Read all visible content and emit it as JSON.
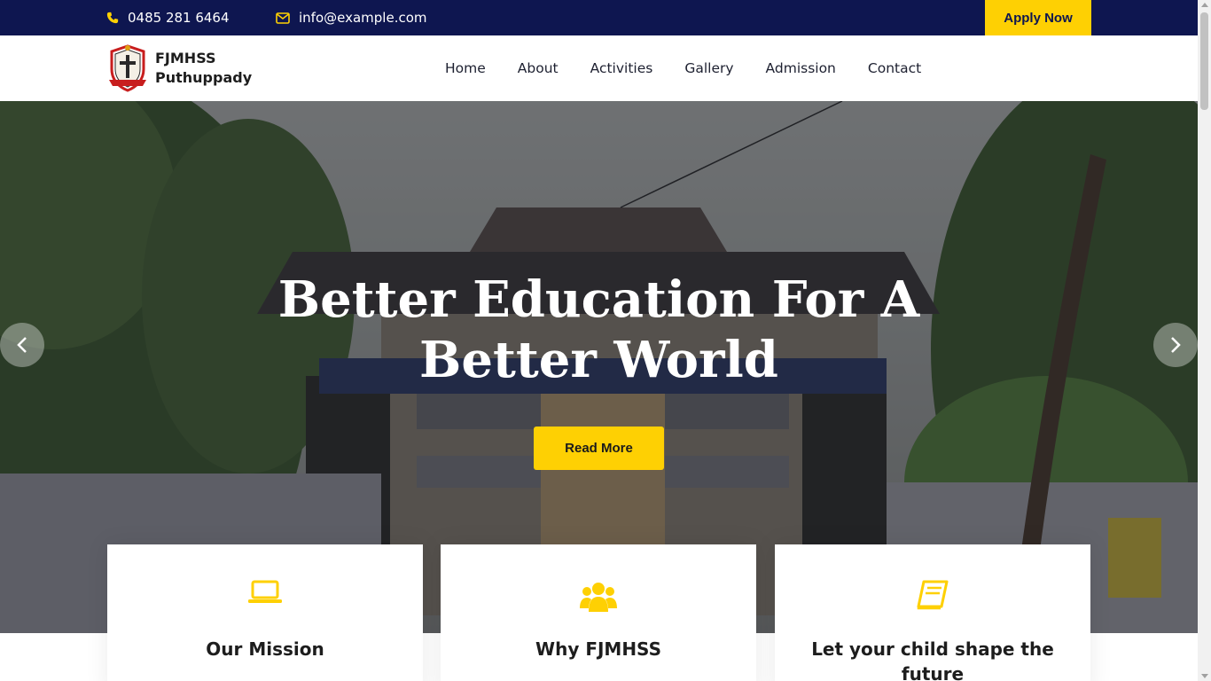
{
  "topbar": {
    "phone": "0485 281 6464",
    "email": "info@example.com",
    "apply_label": "Apply Now",
    "icons": [
      "phone-icon",
      "envelope-icon"
    ]
  },
  "brand": {
    "line1": "FJMHSS",
    "line2": "Puthuppady"
  },
  "nav": {
    "items": [
      {
        "label": "Home"
      },
      {
        "label": "About"
      },
      {
        "label": "Activities"
      },
      {
        "label": "Gallery"
      },
      {
        "label": "Admission"
      },
      {
        "label": "Contact"
      }
    ]
  },
  "hero": {
    "title_line1": "Better Education For A",
    "title_line2": "Better World",
    "button_label": "Read More"
  },
  "features": [
    {
      "title": "Our Mission",
      "icon": "laptop-icon"
    },
    {
      "title": "Why FJMHSS",
      "icon": "users-icon"
    },
    {
      "title": "Let your child shape the future",
      "icon": "book-icon"
    }
  ],
  "colors": {
    "navy": "#0e1650",
    "accent_yellow": "#fed003",
    "text_dark": "#1d1d1d"
  }
}
